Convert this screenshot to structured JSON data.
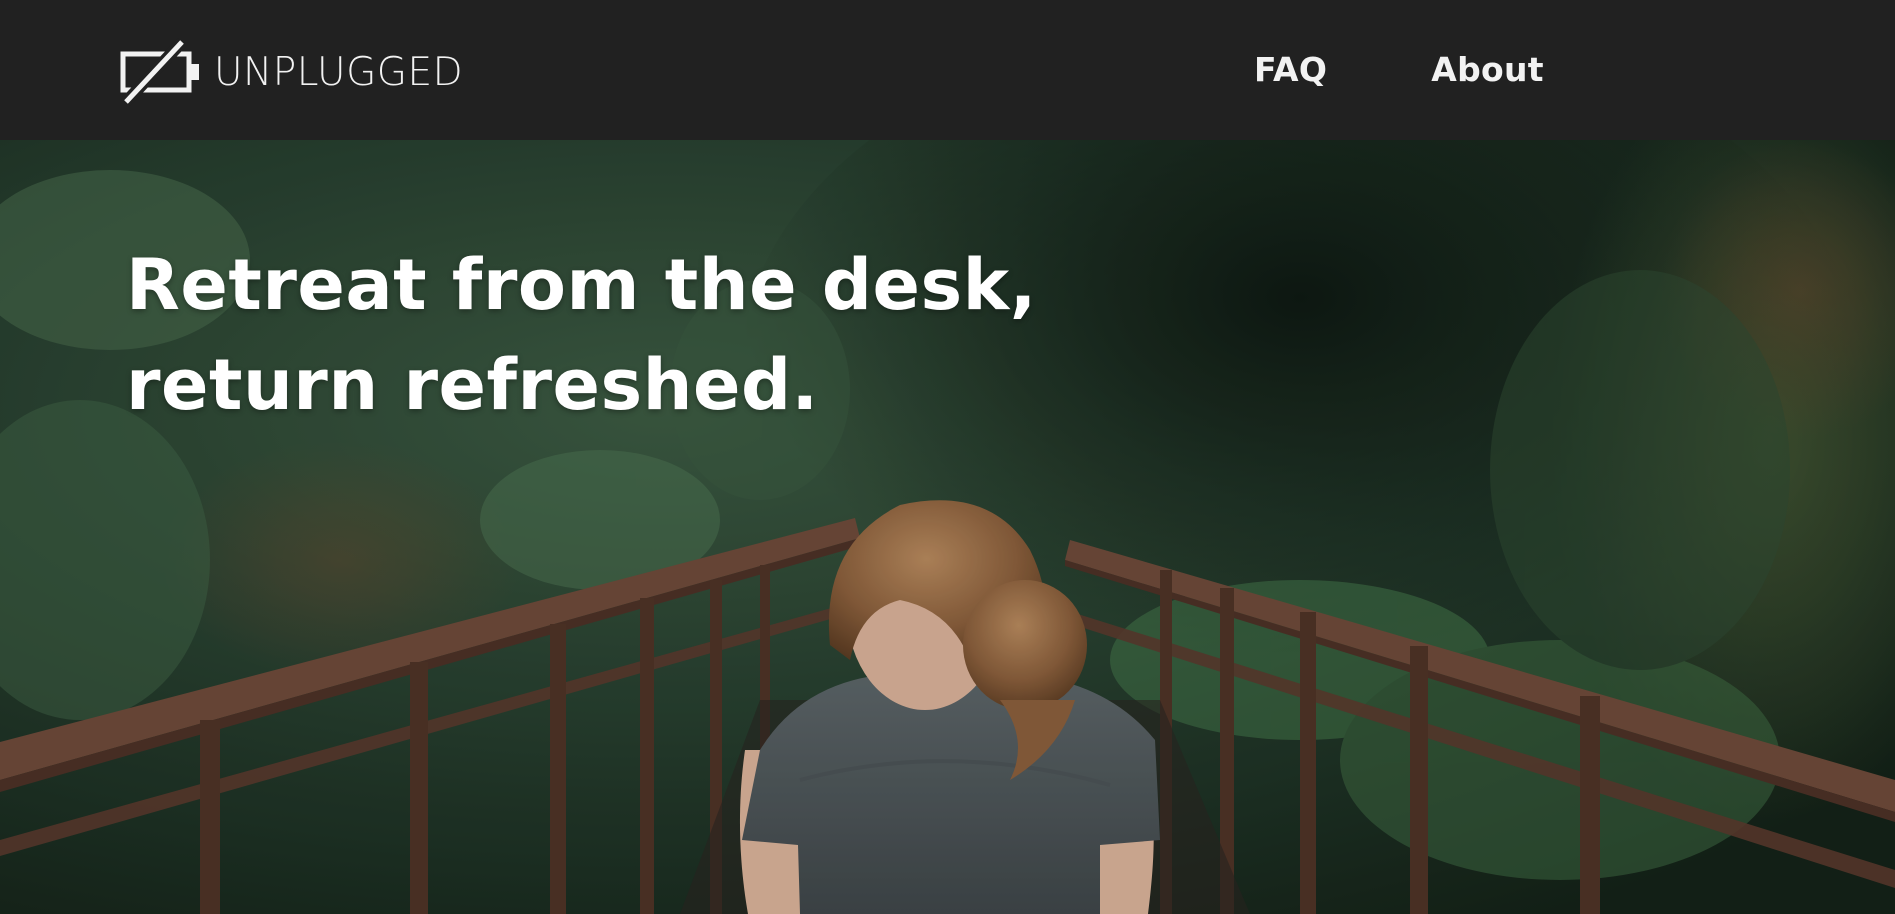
{
  "header": {
    "brand": "UNPLUGGED",
    "logo_icon": "battery-off-icon",
    "nav": [
      {
        "label": "FAQ"
      },
      {
        "label": "About"
      }
    ]
  },
  "hero": {
    "headline_line1": "Retreat from the desk,",
    "headline_line2": "return refreshed.",
    "image": "woman-on-forest-bridge-photo"
  },
  "colors": {
    "navbar_bg": "#212121",
    "nav_text": "#f2f2f2",
    "headline": "#ffffff"
  }
}
